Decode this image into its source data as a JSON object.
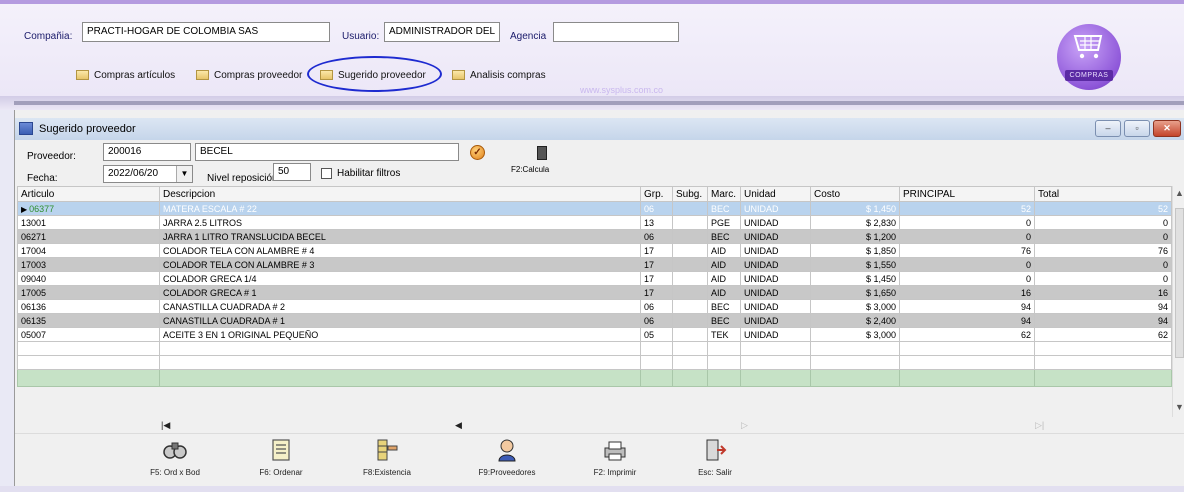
{
  "header": {
    "company_label": "Compañia:",
    "company_value": "PRACTI-HOGAR DE COLOMBIA SAS",
    "user_label": "Usuario:",
    "user_value": "ADMINISTRADOR DEL",
    "agency_label": "Agencia",
    "agency_value": "",
    "nav": [
      {
        "label": "Compras artículos"
      },
      {
        "label": "Compras proveedor"
      },
      {
        "label": "Sugerido proveedor"
      },
      {
        "label": "Analisis compras"
      }
    ],
    "weblink": "www.sysplus.com.co",
    "badge_text": "COMPRAS"
  },
  "window": {
    "title": "Sugerido proveedor",
    "buttons": {
      "minimize": "–",
      "restore": "▫",
      "close": "✕"
    }
  },
  "filters": {
    "proveedor_label": "Proveedor:",
    "proveedor_code": "200016",
    "proveedor_name": "BECEL",
    "fecha_label": "Fecha:",
    "fecha_value": "2022/06/20",
    "nivel_label": "Nivel reposición:",
    "nivel_value": "50",
    "habilitar_label": "Habilitar filtros",
    "calcula_label": "F2:Calcula"
  },
  "grid": {
    "columns": [
      "Articulo",
      "Descripcion",
      "Grp.",
      "Subg.",
      "Marc.",
      "Unidad",
      "Costo",
      "PRINCIPAL",
      "Total"
    ],
    "rows": [
      {
        "articulo": "06377",
        "descripcion": "MATERA ESCALA # 22",
        "grp": "06",
        "subg": "",
        "marc": "BEC",
        "unidad": "UNIDAD",
        "costo": "$ 1,450",
        "principal": "52",
        "total": "52"
      },
      {
        "articulo": "13001",
        "descripcion": "JARRA 2.5 LITROS",
        "grp": "13",
        "subg": "",
        "marc": "PGE",
        "unidad": "UNIDAD",
        "costo": "$ 2,830",
        "principal": "0",
        "total": "0"
      },
      {
        "articulo": "06271",
        "descripcion": "JARRA 1 LITRO TRANSLUCIDA BECEL",
        "grp": "06",
        "subg": "",
        "marc": "BEC",
        "unidad": "UNIDAD",
        "costo": "$ 1,200",
        "principal": "0",
        "total": "0"
      },
      {
        "articulo": "17004",
        "descripcion": "COLADOR TELA CON ALAMBRE # 4",
        "grp": "17",
        "subg": "",
        "marc": "AID",
        "unidad": "UNIDAD",
        "costo": "$ 1,850",
        "principal": "76",
        "total": "76"
      },
      {
        "articulo": "17003",
        "descripcion": "COLADOR TELA CON ALAMBRE # 3",
        "grp": "17",
        "subg": "",
        "marc": "AID",
        "unidad": "UNIDAD",
        "costo": "$ 1,550",
        "principal": "0",
        "total": "0"
      },
      {
        "articulo": "09040",
        "descripcion": "COLADOR GRECA 1/4",
        "grp": "17",
        "subg": "",
        "marc": "AID",
        "unidad": "UNIDAD",
        "costo": "$ 1,450",
        "principal": "0",
        "total": "0"
      },
      {
        "articulo": "17005",
        "descripcion": "COLADOR GRECA # 1",
        "grp": "17",
        "subg": "",
        "marc": "AID",
        "unidad": "UNIDAD",
        "costo": "$ 1,650",
        "principal": "16",
        "total": "16"
      },
      {
        "articulo": "06136",
        "descripcion": "CANASTILLA CUADRADA # 2",
        "grp": "06",
        "subg": "",
        "marc": "BEC",
        "unidad": "UNIDAD",
        "costo": "$ 3,000",
        "principal": "94",
        "total": "94"
      },
      {
        "articulo": "06135",
        "descripcion": "CANASTILLA CUADRADA # 1",
        "grp": "06",
        "subg": "",
        "marc": "BEC",
        "unidad": "UNIDAD",
        "costo": "$ 2,400",
        "principal": "94",
        "total": "94"
      },
      {
        "articulo": "05007",
        "descripcion": "ACEITE 3 EN 1 ORIGINAL PEQUEÑO",
        "grp": "05",
        "subg": "",
        "marc": "TEK",
        "unidad": "UNIDAD",
        "costo": "$ 3,000",
        "principal": "62",
        "total": "62"
      }
    ]
  },
  "toolbar": [
    {
      "label": "F5: Ord x Bod",
      "icon": "binoculars-icon"
    },
    {
      "label": "F6: Ordenar",
      "icon": "list-icon"
    },
    {
      "label": "F8:Existencia",
      "icon": "shelf-icon"
    },
    {
      "label": "F9:Proveedores",
      "icon": "person-icon"
    },
    {
      "label": "F2: Imprimir",
      "icon": "printer-icon"
    },
    {
      "label": "Esc: Salir",
      "icon": "exit-door-icon"
    }
  ],
  "colors": {
    "circle_highlight": "#1e2bd0",
    "selected_row": "#b9d3ee",
    "alt_row": "#c8c8c8",
    "total_row": "#c6e2c6",
    "badge_purple": "#8e57d9"
  }
}
